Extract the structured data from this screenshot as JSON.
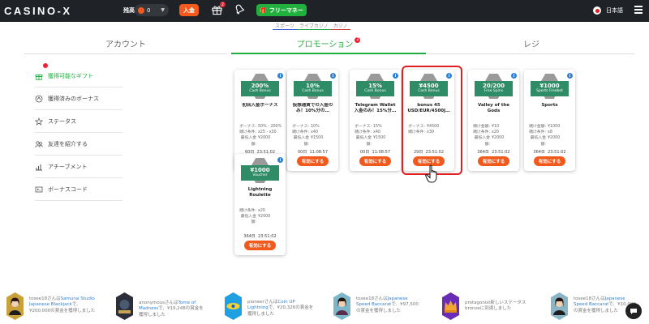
{
  "topbar": {
    "logo": "CASINO-X",
    "balance_label": "残高:",
    "balance_value": "0",
    "deposit_label": "入金",
    "gift_badge": "2",
    "freemoney_label": "フリーマネー",
    "language": "日本語"
  },
  "subnav": [
    "スポーツ",
    "ライブカジノ",
    "カジノ"
  ],
  "tabs": {
    "account": "アカウント",
    "promotion": "プロモーション",
    "promotion_badge": "2",
    "cashier": "レジ"
  },
  "sidebar": {
    "items": [
      {
        "label": "獲得可能なギフト",
        "icon": "gift-icon"
      },
      {
        "label": "獲得済みのボーナス",
        "icon": "bonus-icon"
      },
      {
        "label": "ステータス",
        "icon": "star-icon"
      },
      {
        "label": "友達を紹介する",
        "icon": "friends-icon"
      },
      {
        "label": "アチーブメント",
        "icon": "chart-icon"
      },
      {
        "label": "ボーナスコード",
        "icon": "code-icon"
      }
    ]
  },
  "cards": [
    {
      "badge": "200%",
      "badge_sub": "Cash Bonus",
      "title": "初回入金ボーナス",
      "lines": [
        [
          "ボーナス:",
          "50% - 200%"
        ],
        [
          "賭け条件:",
          "x25 - x30"
        ],
        [
          "最低入金額:",
          "¥2000"
        ]
      ],
      "timer_days": "60日",
      "timer_time": "23:51:02",
      "button": "有効にする"
    },
    {
      "badge": "10%",
      "badge_sub": "Cash Bonus",
      "title": "仮想通貨での入金のみ！10%分の…",
      "lines": [
        [
          "ボーナス:",
          "10%"
        ],
        [
          "賭け条件:",
          "x40"
        ],
        [
          "最低入金額:",
          "¥1500"
        ]
      ],
      "timer_days": "00日",
      "timer_time": "11:08:57",
      "button": "有効にする"
    },
    {
      "badge": "15%",
      "badge_sub": "Cash Bonus",
      "title": "Telegram Wallet入金のみ！15%分…",
      "lines": [
        [
          "ボーナス:",
          "15%"
        ],
        [
          "賭け条件:",
          "x40"
        ],
        [
          "最低入金額:",
          "¥1500"
        ]
      ],
      "timer_days": "00日",
      "timer_time": "11:08:57",
      "button": "有効にする"
    },
    {
      "badge": "¥4500",
      "badge_sub": "Cash Bonus",
      "title": "bonus 45 USD/EUR/4500J…",
      "lines": [
        [
          "ボーナス:",
          "¥4500"
        ],
        [
          "賭け条件:",
          "x30"
        ]
      ],
      "timer_days": "29日",
      "timer_time": "23:51:02",
      "button": "有効にする"
    },
    {
      "badge": "20/200",
      "badge_sub": "Free Spins",
      "title": "Valley of the Gods",
      "lines": [
        [
          "賭け金額:",
          "¥10"
        ],
        [
          "賭け条件:",
          "x20"
        ],
        [
          "最低入金額:",
          "¥2000"
        ]
      ],
      "timer_days": "364日",
      "timer_time": "23:51:02",
      "button": "有効にする"
    },
    {
      "badge": "¥1000",
      "badge_sub": "Sports Freebet",
      "title": "Sports",
      "lines": [
        [
          "賭け金額:",
          "¥1000"
        ],
        [
          "賭け条件:",
          "x8"
        ],
        [
          "最低入金額:",
          "¥2000"
        ]
      ],
      "timer_days": "364日",
      "timer_time": "23:51:02",
      "button": "有効にする"
    },
    {
      "badge": "¥1000",
      "badge_sub": "Voucher",
      "title": "Lightning Roulette",
      "lines": [
        [
          "賭け条件:",
          "x20"
        ],
        [
          "最低入金額:",
          "¥2000"
        ]
      ],
      "timer_days": "364日",
      "timer_time": "23:51:02",
      "button": "有効にする"
    }
  ],
  "feed": [
    {
      "user": "tosee18さんは",
      "link": "Samurai Studio Japanese Blackjack",
      "rest": "で、¥200,000の賞金を獲得しました"
    },
    {
      "user": "anonymousさんは",
      "link": "Tome of Madness",
      "rest": "で、¥19,248の賞金を獲得しました"
    },
    {
      "user": "pioneerさんは",
      "link": "Coin UP Lightning",
      "rest": "で、¥20,326の賞金を獲得しました"
    },
    {
      "user": "tosee18さんは",
      "link": "Japanese Speed Baccarat",
      "rest": "で、¥97,500の賞金を獲得しました"
    },
    {
      "user": "",
      "link": "",
      "rest": "protagonist新しいステータスbronzeに到達しました"
    },
    {
      "user": "tosee18さんは",
      "link": "Japanese Speed Baccarat",
      "rest": "で、¥10,000の賞金を獲得しました"
    }
  ],
  "colors": {
    "accent_orange": "#f25a1d",
    "accent_green": "#21b03d",
    "ribbon_green": "#2e8c67",
    "topbar": "#1f2226",
    "highlight_red": "#e02020"
  }
}
